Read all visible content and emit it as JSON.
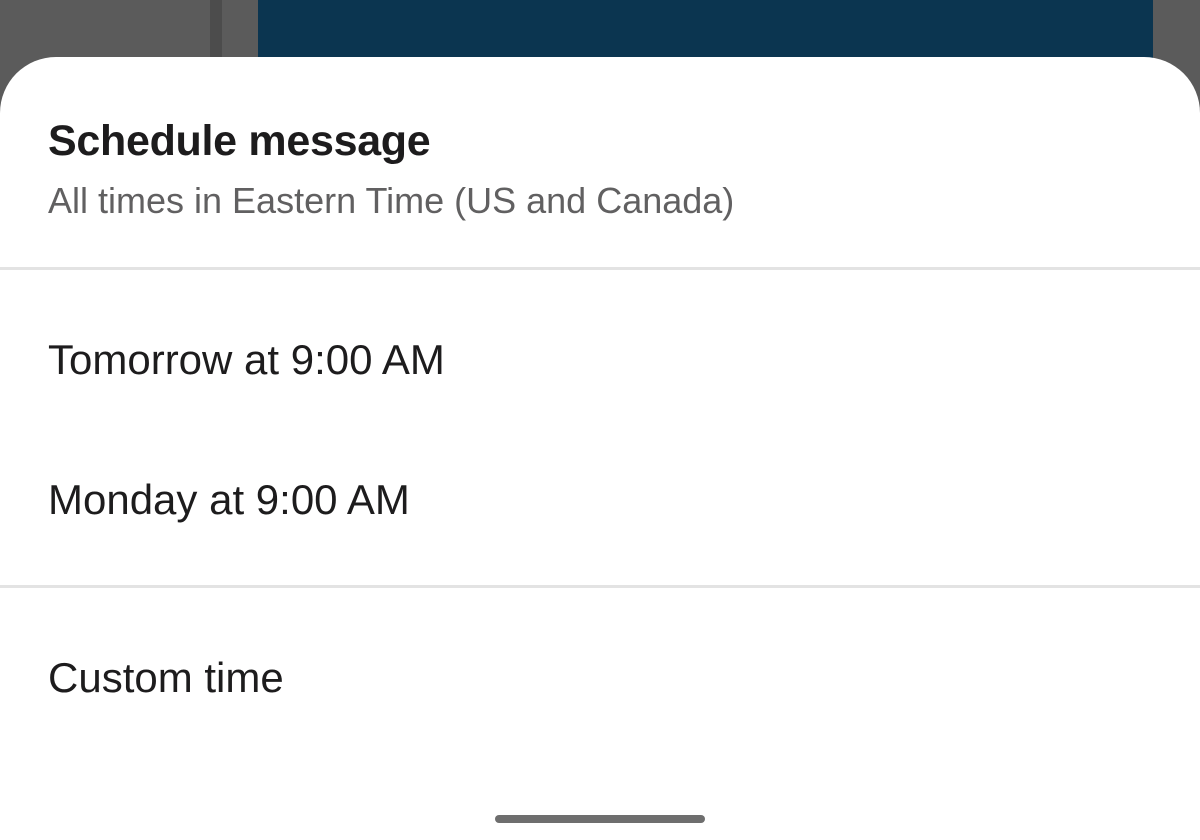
{
  "sheet": {
    "title": "Schedule message",
    "subtitle": "All times in Eastern Time (US and Canada)",
    "options": [
      {
        "label": "Tomorrow at 9:00 AM"
      },
      {
        "label": "Monday at 9:00 AM"
      },
      {
        "label": "Custom time"
      }
    ]
  },
  "colors": {
    "backdrop": "#5b5b5b",
    "header_panel": "#0b3550",
    "sheet_background": "#ffffff",
    "title_text": "#1d1c1d",
    "subtitle_text": "#616061",
    "divider": "#e3e3e3",
    "home_indicator": "#6e6e6e"
  }
}
